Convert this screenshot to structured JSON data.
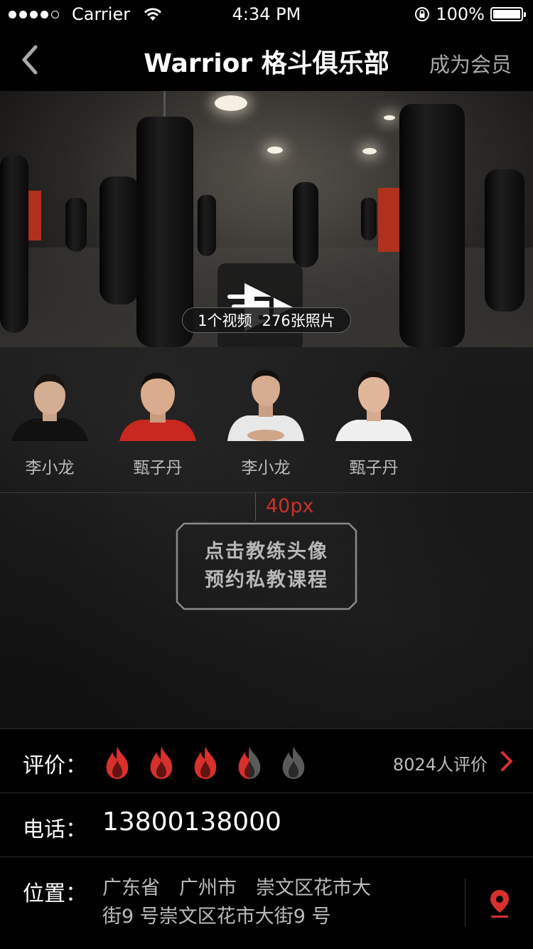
{
  "status_bar": {
    "carrier": "Carrier",
    "time": "4:34 PM",
    "battery": "100%",
    "signal_bars": 5,
    "signal_filled": 4
  },
  "nav": {
    "title": "Warrior 格斗俱乐部",
    "action": "成为会员"
  },
  "hero": {
    "media_videos": "1个视频",
    "media_photos": "276张照片"
  },
  "coaches": [
    {
      "name": "李小龙"
    },
    {
      "name": "甄子丹"
    },
    {
      "name": "李小龙"
    },
    {
      "name": "甄子丹"
    }
  ],
  "annotation": {
    "spacing_label": "40px"
  },
  "hint": {
    "line1": "点击教练头像",
    "line2": "预约私教课程"
  },
  "rating": {
    "label": "评价：",
    "count_text": "8024人评价",
    "score": 3.5,
    "max": 5
  },
  "phone": {
    "label": "电话：",
    "value": "13800138000"
  },
  "location": {
    "label": "位置：",
    "address": "广东省　广州市　崇文区花市大街9 号崇文区花市大街9 号"
  },
  "colors": {
    "accent_red": "#d8302c",
    "flame_gray": "#5a5a5a",
    "nav_action": "#a8a8a8"
  },
  "icons": {
    "back": "chevron-left-icon",
    "play": "play-icon",
    "rating_unit": "flame-icon",
    "more": "chevron-right-icon",
    "location": "map-pin-icon"
  }
}
